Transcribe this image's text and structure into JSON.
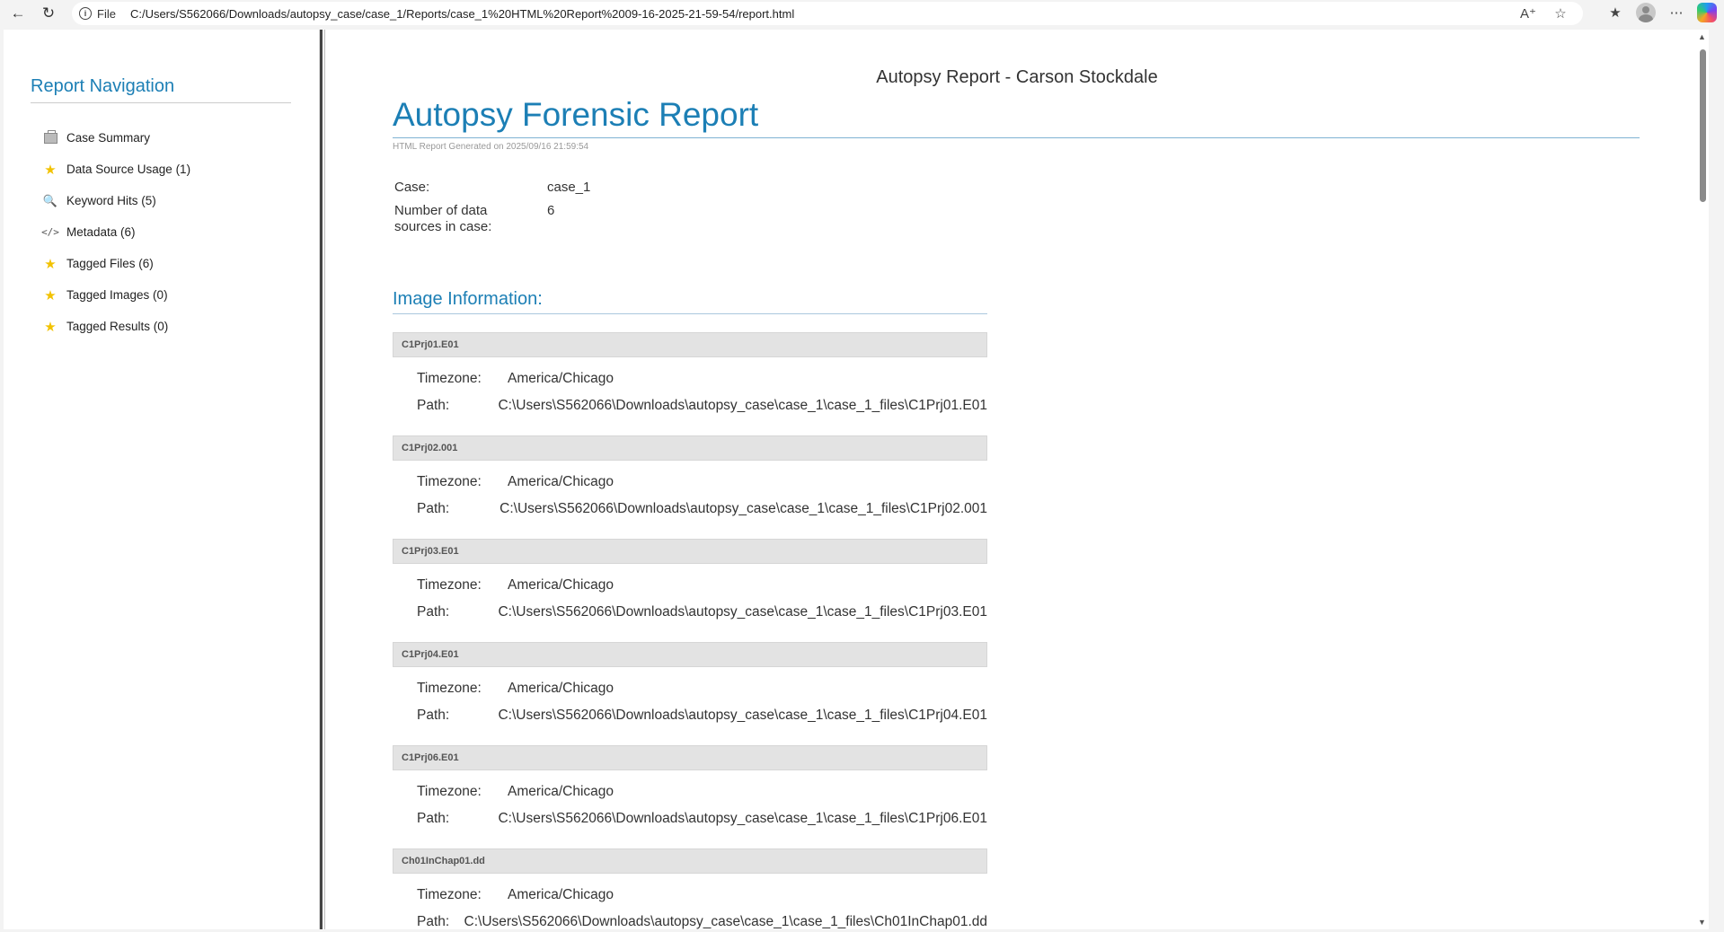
{
  "browser": {
    "file_label": "File",
    "url": "C:/Users/S562066/Downloads/autopsy_case/case_1/Reports/case_1%20HTML%20Report%2009-16-2025-21-59-54/report.html",
    "icons": [
      "back-icon",
      "refresh-icon",
      "info-icon",
      "read-aloud-icon",
      "favorite-star-icon",
      "favorites-icon",
      "profile-icon",
      "more-icon",
      "copilot-icon"
    ]
  },
  "nav": {
    "title": "Report Navigation",
    "items": [
      {
        "label": "Case Summary",
        "icon": "briefcase-icon"
      },
      {
        "label": "Data Source Usage (1)",
        "icon": "star-icon"
      },
      {
        "label": "Keyword Hits (5)",
        "icon": "search-icon"
      },
      {
        "label": "Metadata (6)",
        "icon": "code-icon"
      },
      {
        "label": "Tagged Files (6)",
        "icon": "star-icon"
      },
      {
        "label": "Tagged Images (0)",
        "icon": "star-icon"
      },
      {
        "label": "Tagged Results (0)",
        "icon": "star-icon"
      }
    ]
  },
  "report": {
    "header": "Autopsy Report - Carson Stockdale",
    "title": "Autopsy Forensic Report",
    "generated": "HTML Report Generated on 2025/09/16 21:59:54",
    "case_label": "Case:",
    "case_value": "case_1",
    "sources_label_line1": "Number of data",
    "sources_label_line2": "sources in case:",
    "sources_value": "6",
    "image_info_title": "Image Information:",
    "timezone_label": "Timezone:",
    "path_label": "Path:",
    "images": [
      {
        "name": "C1Prj01.E01",
        "timezone": "America/Chicago",
        "path": "C:\\Users\\S562066\\Downloads\\autopsy_case\\case_1\\case_1_files\\C1Prj01.E01"
      },
      {
        "name": "C1Prj02.001",
        "timezone": "America/Chicago",
        "path": "C:\\Users\\S562066\\Downloads\\autopsy_case\\case_1\\case_1_files\\C1Prj02.001"
      },
      {
        "name": "C1Prj03.E01",
        "timezone": "America/Chicago",
        "path": "C:\\Users\\S562066\\Downloads\\autopsy_case\\case_1\\case_1_files\\C1Prj03.E01"
      },
      {
        "name": "C1Prj04.E01",
        "timezone": "America/Chicago",
        "path": "C:\\Users\\S562066\\Downloads\\autopsy_case\\case_1\\case_1_files\\C1Prj04.E01"
      },
      {
        "name": "C1Prj06.E01",
        "timezone": "America/Chicago",
        "path": "C:\\Users\\S562066\\Downloads\\autopsy_case\\case_1\\case_1_files\\C1Prj06.E01"
      },
      {
        "name": "Ch01InChap01.dd",
        "timezone": "America/Chicago",
        "path": "C:\\Users\\S562066\\Downloads\\autopsy_case\\case_1\\case_1_files\\Ch01InChap01.dd"
      }
    ]
  }
}
